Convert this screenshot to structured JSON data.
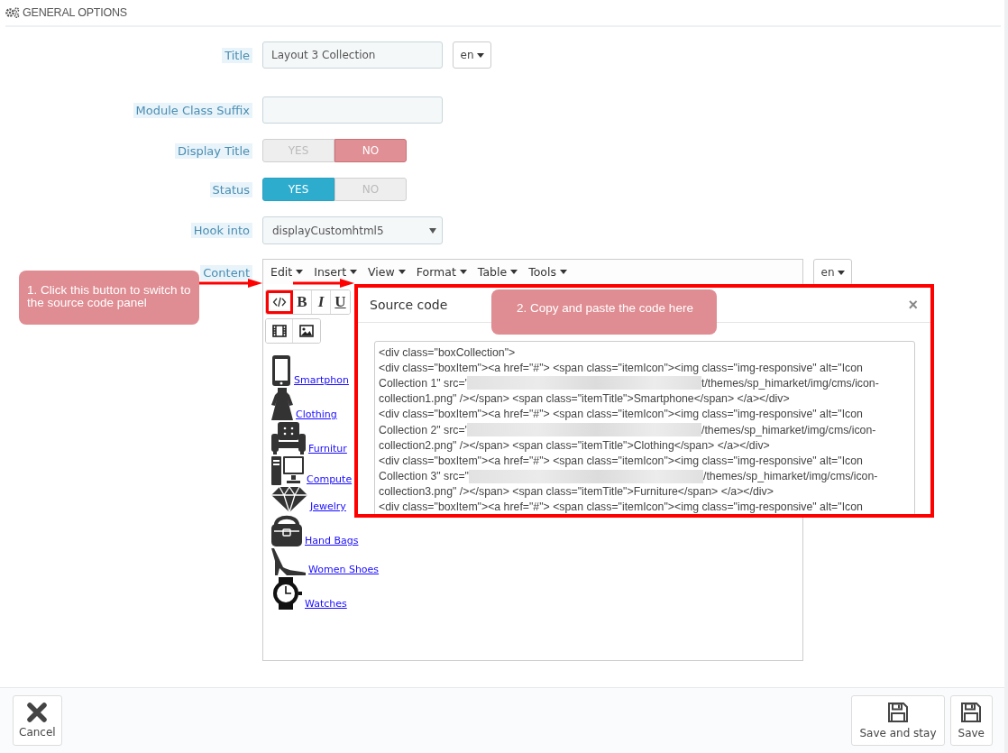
{
  "header": {
    "title": "GENERAL OPTIONS"
  },
  "fields": [
    {
      "kind": "text",
      "label": "Title",
      "value": "Layout 3 Collection",
      "language": "en"
    },
    {
      "kind": "text",
      "label": "Module Class Suffix"
    },
    {
      "kind": "switch",
      "label": "Display Title",
      "options": [
        {
          "label": "YES",
          "selected": false
        },
        {
          "label": "NO",
          "selected": true
        }
      ]
    },
    {
      "kind": "switch",
      "label": "Status",
      "options": [
        {
          "label": "YES",
          "selected": true
        },
        {
          "label": "NO",
          "selected": false
        }
      ]
    },
    {
      "kind": "select",
      "label": "Hook into",
      "value": "displayCustomhtml5"
    }
  ],
  "content": {
    "label": "Content",
    "language": "en",
    "menus": [
      "Edit",
      "Insert",
      "View",
      "Format",
      "Table",
      "Tools"
    ],
    "toolbar_rows": [
      [
        {
          "kind": "source"
        },
        {
          "kind": "bold",
          "text": "B"
        },
        {
          "kind": "italic",
          "text": "I"
        },
        {
          "kind": "underline",
          "text": "U"
        }
      ],
      [
        {
          "kind": "video"
        },
        {
          "kind": "image"
        }
      ]
    ],
    "items": [
      {
        "kind": "phone",
        "label": "Smartphon"
      },
      {
        "kind": "dress",
        "label": "Clothing"
      },
      {
        "kind": "armchair",
        "label": "Furnitur"
      },
      {
        "kind": "computer",
        "label": "Compute"
      },
      {
        "kind": "diamond",
        "label": "Jewelry"
      },
      {
        "kind": "handbag",
        "label": "Hand Bags"
      },
      {
        "kind": "heel",
        "label": "Women Shoes"
      },
      {
        "kind": "watch",
        "label": "Watches"
      }
    ]
  },
  "dialog": {
    "title": "Source code",
    "close": "×",
    "code_lines": [
      [
        {
          "kind": "text",
          "text": "<div class=\"boxCollection\">"
        }
      ],
      [
        {
          "kind": "text",
          "text": "<div class=\"boxItem\"><a href=\"#\"> <span class=\"itemIcon\"><img class=\"img-responsive\" alt=\"Icon"
        }
      ],
      [
        {
          "kind": "text",
          "text": "Collection 1\" src='"
        },
        {
          "kind": "redacted"
        },
        {
          "kind": "text",
          "text": "t/themes/sp_himarket/img/cms/icon-"
        }
      ],
      [
        {
          "kind": "text",
          "text": "collection1.png\" /></span> <span class=\"itemTitle\">Smartphone</span> </a></div>"
        }
      ],
      [
        {
          "kind": "text",
          "text": "<div class=\"boxItem\"><a href=\"#\"> <span class=\"itemIcon\"><img class=\"img-responsive\" alt=\"Icon"
        }
      ],
      [
        {
          "kind": "text",
          "text": "Collection 2\" src='"
        },
        {
          "kind": "redacted"
        },
        {
          "kind": "text",
          "text": "/themes/sp_himarket/img/cms/icon-"
        }
      ],
      [
        {
          "kind": "text",
          "text": "collection2.png\" /></span> <span class=\"itemTitle\">Clothing</span> </a></div>"
        }
      ],
      [
        {
          "kind": "text",
          "text": "<div class=\"boxItem\"><a href=\"#\"> <span class=\"itemIcon\"><img class=\"img-responsive\" alt=\"Icon"
        }
      ],
      [
        {
          "kind": "text",
          "text": "Collection 3\" src=\""
        },
        {
          "kind": "redacted"
        },
        {
          "kind": "text",
          "text": "/themes/sp_himarket/img/cms/icon-"
        }
      ],
      [
        {
          "kind": "text",
          "text": "collection3.png\" /></span> <span class=\"itemTitle\">Furniture</span> </a></div>"
        }
      ],
      [
        {
          "kind": "text",
          "text": "<div class=\"boxItem\"><a href=\"#\"> <span class=\"itemIcon\"><img class=\"img-responsive\" alt=\"Icon"
        }
      ]
    ]
  },
  "callouts": [
    {
      "text": "1. Click this button to switch to the source code panel"
    },
    {
      "text": "2. Copy and paste the code here"
    }
  ],
  "footer": {
    "buttons": [
      {
        "kind": "cancel",
        "label": "Cancel"
      },
      {
        "kind": "save",
        "label": "Save and stay"
      },
      {
        "kind": "save",
        "label": "Save"
      }
    ]
  }
}
